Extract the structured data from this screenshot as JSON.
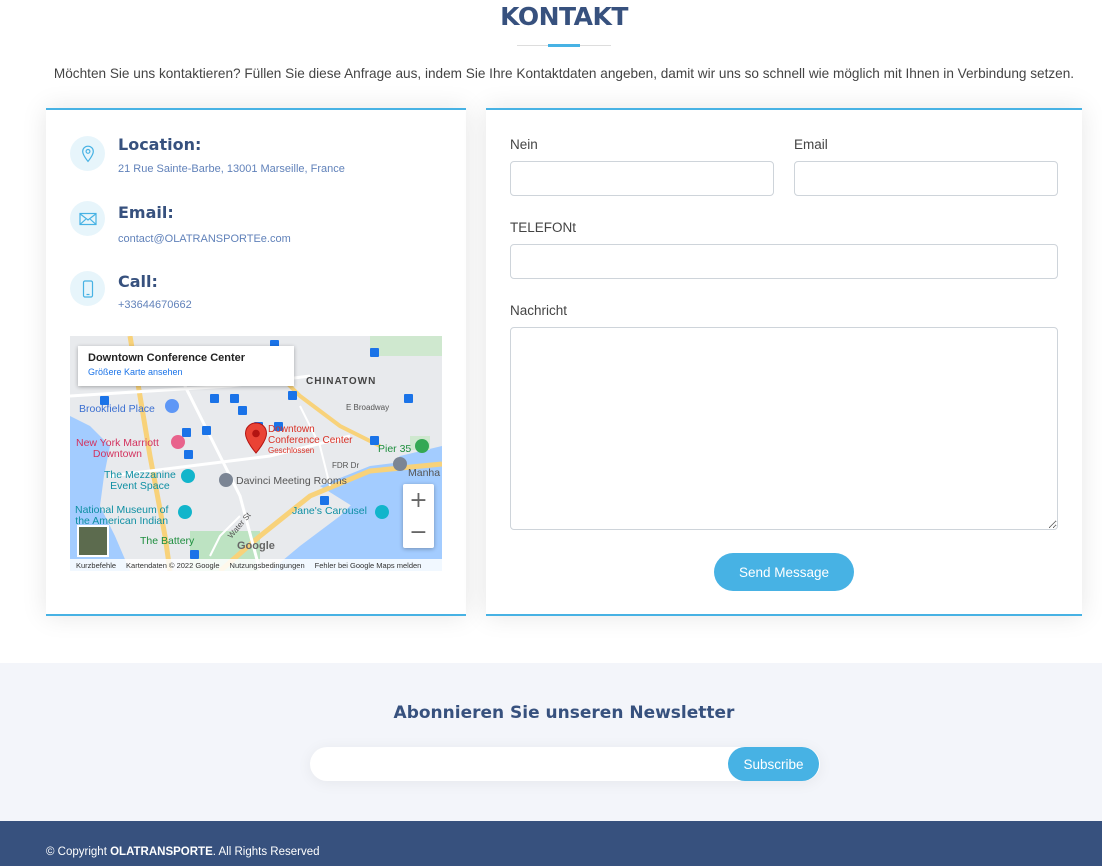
{
  "section": {
    "title": "KONTAKT",
    "intro": "Möchten Sie uns kontaktieren? Füllen Sie diese Anfrage aus, indem Sie Ihre Kontaktdaten angeben, damit wir uns so schnell wie möglich mit Ihnen in Verbindung setzen."
  },
  "info": {
    "location_heading": "Location:",
    "location_text": "21 Rue Sainte-Barbe, 13001 Marseille, France",
    "email_heading": "Email:",
    "email_text": "contact@OLATRANSPORTEe.com",
    "call_heading": "Call:",
    "call_text": "+33644670662"
  },
  "map": {
    "place_name": "Downtown Conference Center",
    "larger_map_link": "Größere Karte ansehen",
    "labels": {
      "chinatown": "CHINATOWN",
      "e_broadway": "E Broadway",
      "brookfield": "Brookfield Place",
      "marriott": "New York Marriott\nDowntown",
      "pin_name": "Downtown\nConference Center",
      "pin_status": "Geschlossen",
      "pier35": "Pier 35",
      "fdr": "FDR Dr",
      "manha": "Manha",
      "mezzanine": "The Mezzanine\nEvent Space",
      "davinci": "Davinci Meeting Rooms",
      "national_museum": "National Museum of\nthe American Indian",
      "janes": "Jane's Carousel",
      "water_st": "Water St",
      "battery": "The Battery",
      "google": "Google"
    },
    "zoom_in": "+",
    "zoom_out": "−",
    "footer": {
      "shortcuts": "Kurzbefehle",
      "map_data": "Kartendaten © 2022 Google",
      "terms": "Nutzungsbedingungen",
      "report": "Fehler bei Google Maps melden"
    }
  },
  "form": {
    "name_label": "Nein",
    "email_label": "Email",
    "phone_label": "TELEFONt",
    "message_label": "Nachricht",
    "name_value": "",
    "email_value": "",
    "phone_value": "",
    "message_value": "",
    "send_label": "Send Message"
  },
  "newsletter": {
    "title": "Abonnieren Sie unseren Newsletter",
    "input_value": "",
    "subscribe_label": "Subscribe"
  },
  "footer": {
    "copyright_prefix": "© Copyright ",
    "brand": "OLATRANSPORTE",
    "copyright_suffix": ". All Rights Reserved"
  },
  "colors": {
    "primary": "#37517e",
    "accent": "#47b2e4",
    "newsletter_bg": "#f3f5fa",
    "icon_bg": "#e7f5fb"
  },
  "icons": [
    "map-pin-icon",
    "envelope-icon",
    "phone-icon",
    "red-map-pin-icon"
  ]
}
